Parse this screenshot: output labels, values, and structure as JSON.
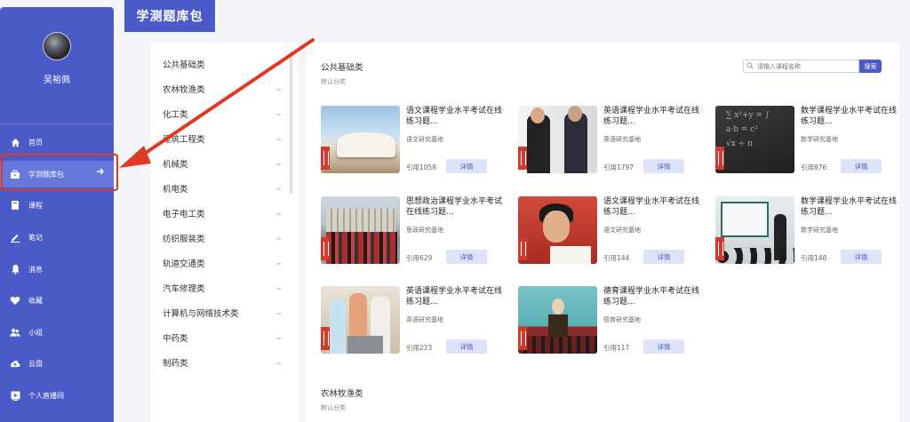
{
  "sidebar": {
    "username": "吴裕佩",
    "nav": [
      {
        "label": "首页",
        "icon": "home-icon"
      },
      {
        "label": "学测题库包",
        "icon": "toolbox-icon",
        "active": true
      },
      {
        "label": "课程",
        "icon": "book-icon"
      },
      {
        "label": "笔记",
        "icon": "pen-icon"
      },
      {
        "label": "消息",
        "icon": "bell-icon"
      },
      {
        "label": "收藏",
        "icon": "heart-icon"
      },
      {
        "label": "小组",
        "icon": "group-icon"
      },
      {
        "label": "云盘",
        "icon": "cloud-upload-icon"
      },
      {
        "label": "个人直播间",
        "icon": "play-icon"
      }
    ]
  },
  "header": {
    "title": "学测题库包"
  },
  "categories": [
    "公共基础类",
    "农林牧渔类",
    "化工类",
    "建筑工程类",
    "机械类",
    "机电类",
    "电子电工类",
    "纺织服装类",
    "轨道交通类",
    "汽车修理类",
    "计算机与网络技术类",
    "中药类",
    "制药类"
  ],
  "search": {
    "placeholder": "请输入课程名称",
    "button": "搜索"
  },
  "sections": [
    {
      "title": "公共基础类",
      "subtitle": "默认分类"
    },
    {
      "title": "农林牧渔类",
      "subtitle": "默认分类"
    }
  ],
  "courses": [
    {
      "title": "语文课程学业水平考试在线练习题...",
      "base": "语文研究基地",
      "refs": "引用1058",
      "detail": "详情"
    },
    {
      "title": "英语课程学业水平考试在线练习题...",
      "base": "英语研究基地",
      "refs": "引用1797",
      "detail": "详情"
    },
    {
      "title": "数学课程学业水平考试在线练习题...",
      "base": "数学研究基地",
      "refs": "引用876",
      "detail": "详情"
    },
    {
      "title": "思想政治课程学业水平考试在线练习题...",
      "base": "思政研究基地",
      "refs": "引用629",
      "detail": "详情"
    },
    {
      "title": "语文课程学业水平考试在线练习题...",
      "base": "语文研究基地",
      "refs": "引用144",
      "detail": "详情"
    },
    {
      "title": "数学课程学业水平考试在线练习题...",
      "base": "数学研究基地",
      "refs": "引用148",
      "detail": "详情"
    },
    {
      "title": "英语课程学业水平考试在线练习题...",
      "base": "英语研究基地",
      "refs": "引用223",
      "detail": "详情"
    },
    {
      "title": "德育课程学业水平考试在线练习题...",
      "base": "德育研究基地",
      "refs": "引用117",
      "detail": "详情"
    }
  ],
  "colors": {
    "primary": "#4a5bc7",
    "active": "#6678dc",
    "annotation": "#e03a26"
  }
}
